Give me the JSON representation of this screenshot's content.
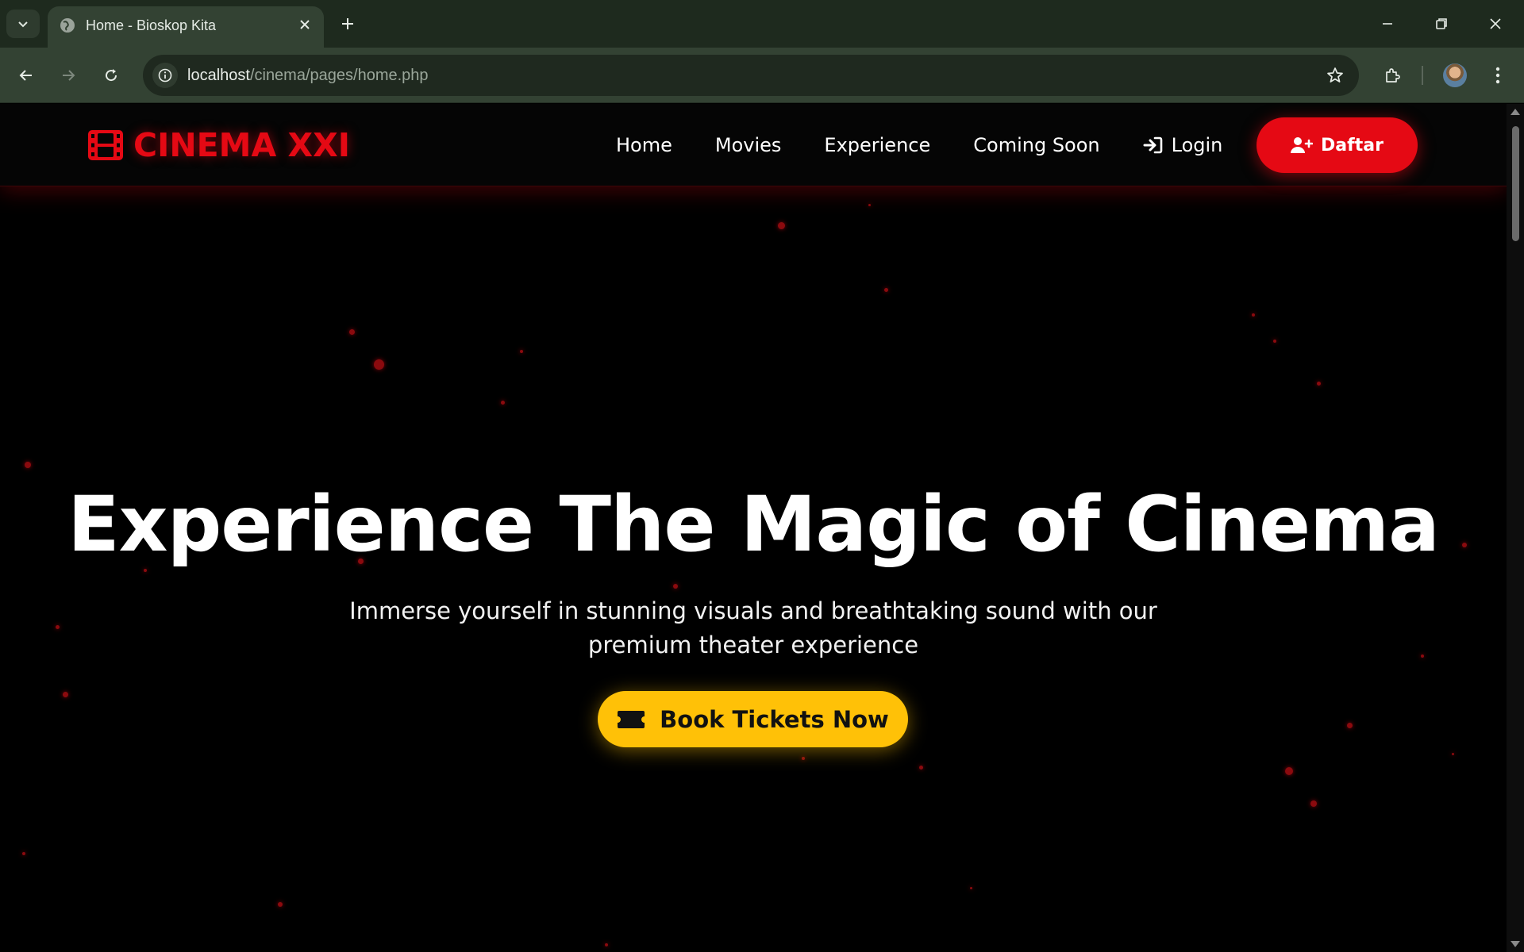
{
  "browser": {
    "tab_title": "Home - Bioskop Kita",
    "url_host": "localhost",
    "url_path": "/cinema/pages/home.php"
  },
  "site": {
    "brand": "CINEMA XXI",
    "nav": {
      "home": "Home",
      "movies": "Movies",
      "experience": "Experience",
      "coming_soon": "Coming Soon",
      "login": "Login"
    },
    "register_label": "Daftar"
  },
  "hero": {
    "title": "Experience The Magic of Cinema",
    "subtitle": "Immerse yourself in stunning visuals and breathtaking sound with our premium theater experience",
    "cta_label": "Book Tickets Now"
  },
  "colors": {
    "brand_red": "#e50914",
    "cta_yellow": "#ffc107",
    "background": "#000000",
    "chrome": "#334233"
  },
  "icons": [
    "tab-search-icon",
    "globe-icon",
    "close-icon",
    "plus-icon",
    "minimize-icon",
    "restore-icon",
    "back-icon",
    "forward-icon",
    "reload-icon",
    "site-info-icon",
    "star-icon",
    "extensions-icon",
    "menu-icon",
    "film-icon",
    "login-icon",
    "user-plus-icon",
    "ticket-icon"
  ]
}
